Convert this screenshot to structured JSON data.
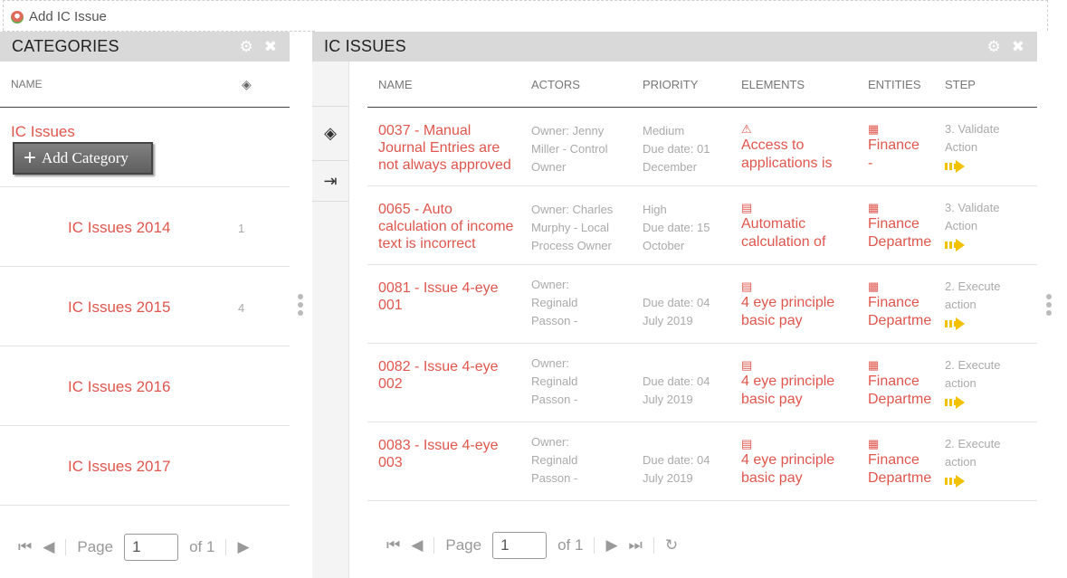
{
  "toolbar": {
    "add_issue_label": "Add IC Issue"
  },
  "categories_panel": {
    "title": "CATEGORIES",
    "column_name": "NAME",
    "root_item": "IC Issues",
    "add_category_label": "Add Category",
    "items": [
      {
        "label": "IC Issues 2014",
        "count": "1"
      },
      {
        "label": "IC Issues 2015",
        "count": "4"
      },
      {
        "label": "IC Issues 2016",
        "count": ""
      },
      {
        "label": "IC Issues 2017",
        "count": ""
      }
    ],
    "pager": {
      "page_label": "Page",
      "page_value": "1",
      "of_label": "of 1"
    }
  },
  "issues_panel": {
    "title": "IC ISSUES",
    "columns": [
      "NAME",
      "ACTORS",
      "PRIORITY",
      "ELEMENTS",
      "ENTITIES",
      "STEP"
    ],
    "rows": [
      {
        "name": [
          "0037 - Manual",
          "Journal Entries are",
          "not always approved"
        ],
        "actors": [
          "Owner: Jenny",
          "Miller - Control",
          "Owner"
        ],
        "priority": [
          "Medium",
          "Due date: 01",
          "December"
        ],
        "element_icon": "warning-icon",
        "element": [
          "Access to",
          "applications is"
        ],
        "entity": [
          "Finance",
          "-"
        ],
        "step": [
          "3. Validate",
          "Action"
        ]
      },
      {
        "name": [
          "0065 - Auto",
          "calculation of income",
          "text is incorrect"
        ],
        "actors": [
          "Owner: Charles",
          "Murphy - Local",
          "Process Owner"
        ],
        "priority": [
          "High",
          "Due date: 15",
          "October"
        ],
        "element_icon": "book-icon",
        "element": [
          "Automatic",
          "calculation of"
        ],
        "entity": [
          "Finance",
          "Departme"
        ],
        "step": [
          "3. Validate",
          "Action"
        ]
      },
      {
        "name": [
          "0081 - Issue 4-eye",
          "001"
        ],
        "actors": [
          "Owner:",
          "Reginald",
          "Passon -"
        ],
        "priority": [
          "",
          "Due date: 04",
          "July 2019"
        ],
        "element_icon": "book-icon",
        "element": [
          "4 eye principle",
          "basic pay"
        ],
        "entity": [
          "Finance",
          "Departme"
        ],
        "step": [
          "2. Execute",
          "action"
        ]
      },
      {
        "name": [
          "0082 - Issue 4-eye",
          "002"
        ],
        "actors": [
          "Owner:",
          "Reginald",
          "Passon -"
        ],
        "priority": [
          "",
          "Due date: 04",
          "July 2019"
        ],
        "element_icon": "book-icon",
        "element": [
          "4 eye principle",
          "basic pay"
        ],
        "entity": [
          "Finance",
          "Departme"
        ],
        "step": [
          "2. Execute",
          "action"
        ]
      },
      {
        "name": [
          "0083 - Issue 4-eye",
          "003"
        ],
        "actors": [
          "Owner:",
          "Reginald",
          "Passon -"
        ],
        "priority": [
          "",
          "Due date: 04",
          "July 2019"
        ],
        "element_icon": "book-icon",
        "element": [
          "4 eye principle",
          "basic pay"
        ],
        "entity": [
          "Finance",
          "Departme"
        ],
        "step": [
          "2. Execute",
          "action"
        ]
      }
    ],
    "pager": {
      "page_label": "Page",
      "page_value": "1",
      "of_label": "of 1"
    }
  },
  "colors": {
    "accent": "#e0564d",
    "header_bg": "#d9d9d9",
    "step_arrow": "#f2c200"
  }
}
